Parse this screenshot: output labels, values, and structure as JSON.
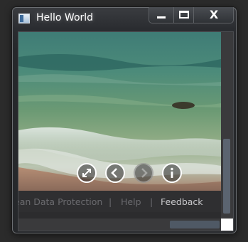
{
  "window": {
    "title": "Hello World",
    "app_icon": "window-app-icon",
    "caption_buttons": [
      {
        "name": "minimize-button",
        "icon": "minimize-icon"
      },
      {
        "name": "maximize-button",
        "icon": "maximize-icon"
      },
      {
        "name": "close-button",
        "icon": "close-icon",
        "glyph": "X"
      }
    ]
  },
  "viewer": {
    "controls": [
      {
        "name": "fullscreen-button",
        "icon": "expand-icon",
        "enabled": true
      },
      {
        "name": "previous-button",
        "icon": "chevron-left-icon",
        "enabled": true
      },
      {
        "name": "next-button",
        "icon": "chevron-right-icon",
        "enabled": false
      },
      {
        "name": "info-button",
        "icon": "info-icon",
        "enabled": true
      }
    ]
  },
  "footer": {
    "links": [
      "ean Data Protection",
      "Help",
      "Feedback"
    ],
    "separator": "|"
  },
  "colors": {
    "title_text": "#ffffff",
    "footer_text": "#6e6e72",
    "footer_highlight": "#c9c9cc",
    "scrollbar_thumb": "#5b6470"
  }
}
